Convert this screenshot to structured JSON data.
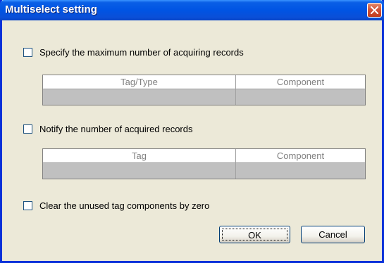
{
  "window": {
    "title": "Multiselect setting"
  },
  "options": {
    "max_records": {
      "label": "Specify the maximum number of acquiring records",
      "checked": false
    },
    "notify_records": {
      "label": "Notify the number of acquired records",
      "checked": false
    },
    "clear_unused": {
      "label": "Clear the unused tag components by zero",
      "checked": false
    }
  },
  "grid1": {
    "columns": [
      "Tag/Type",
      "Component"
    ]
  },
  "grid2": {
    "columns": [
      "Tag",
      "Component"
    ]
  },
  "buttons": {
    "ok": "OK",
    "cancel": "Cancel"
  },
  "colors": {
    "titlebar": "#0054E3",
    "window_bg": "#ECE9D8",
    "grid_row": "#C0C0C0",
    "close_button": "#D2543A"
  },
  "icons": {
    "close": "close-icon"
  }
}
